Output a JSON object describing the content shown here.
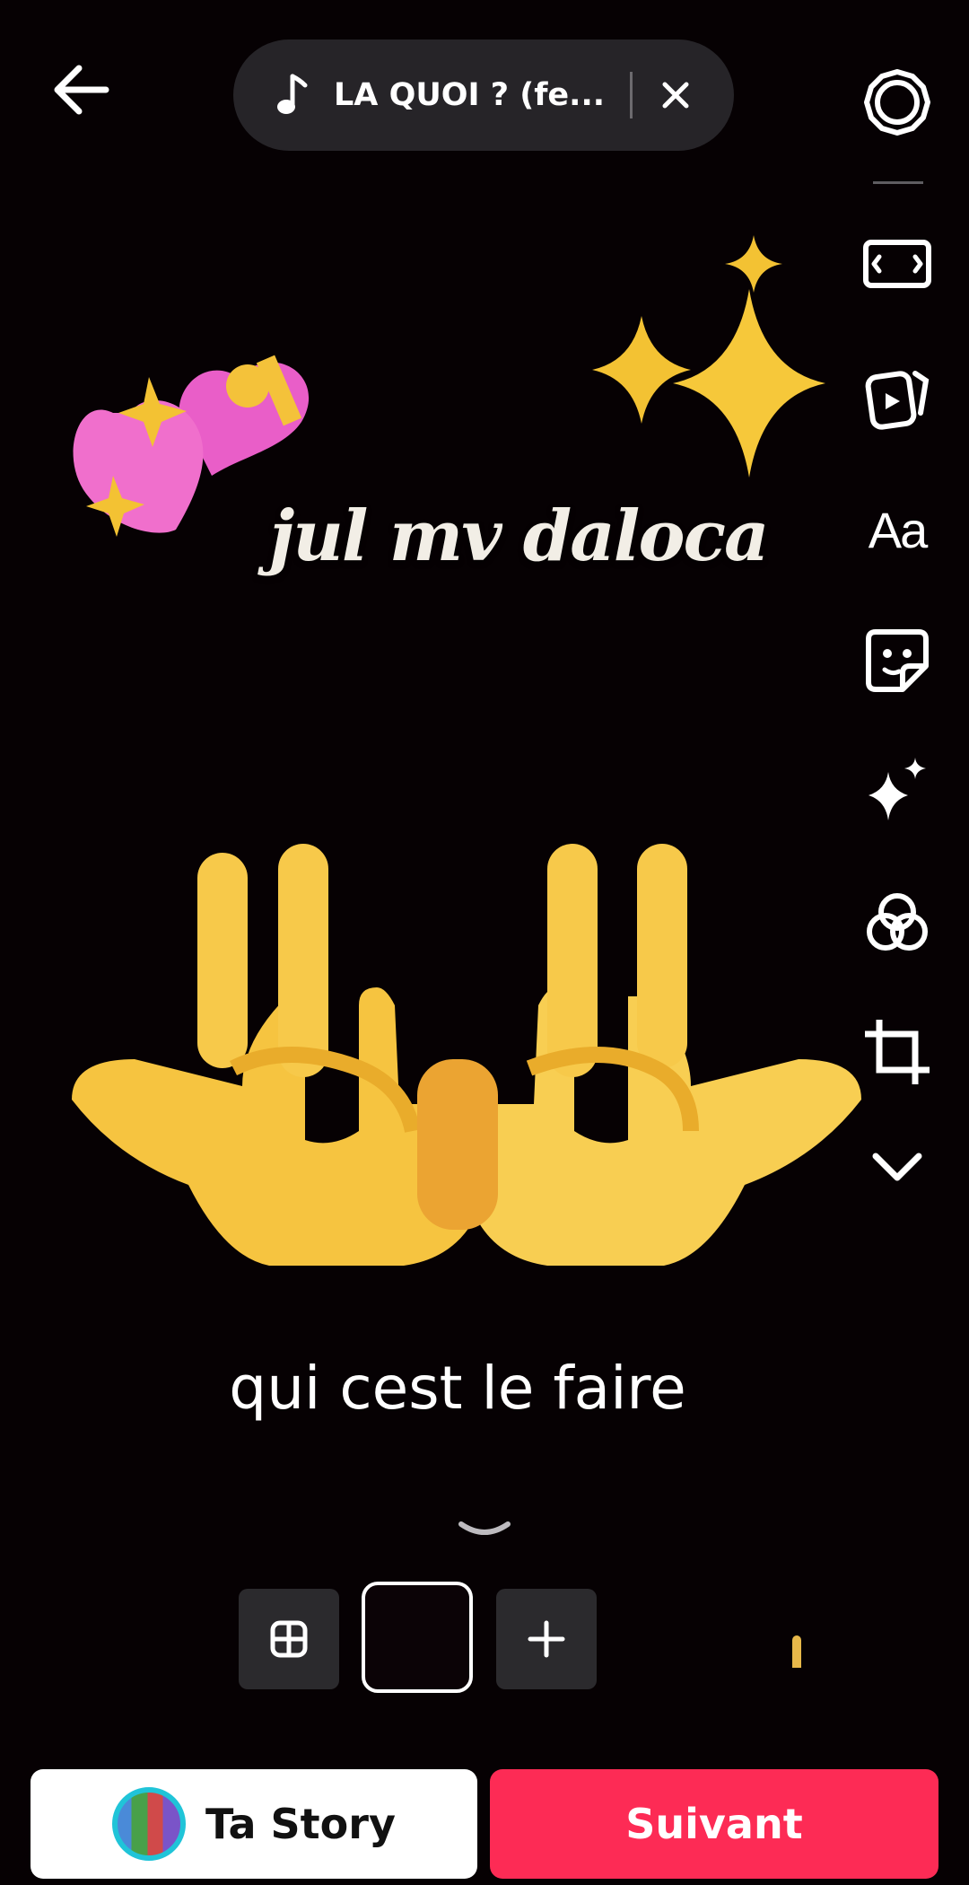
{
  "music": {
    "title": "LA QUOI ? (fe...",
    "icon": "music-note-icon",
    "close_icon": "close-icon"
  },
  "top": {
    "back_icon": "arrow-left-icon"
  },
  "rail": {
    "settings_icon": "gear-icon",
    "aspect_icon": "aspect-ratio-icon",
    "templates_icon": "video-templates-icon",
    "text_label": "Aa",
    "sticker_icon": "sticker-icon",
    "effects_icon": "sparkles-icon",
    "filters_icon": "filters-icon",
    "crop_icon": "crop-icon",
    "more_icon": "chevron-down-icon"
  },
  "canvas": {
    "sticker_text": "jul mv daloca",
    "caption": "qui cest le faire",
    "emoji_stickers": [
      "hearts-emoji",
      "sparkles-emoji",
      "hand-gesture-emoji"
    ]
  },
  "clips": {
    "collapse_icon": "chevron-down-icon",
    "grid_icon": "grid-icon",
    "add_icon": "plus-icon"
  },
  "bottom": {
    "story_label": "Ta Story",
    "next_label": "Suivant"
  },
  "colors": {
    "accent": "#fd2b55",
    "background": "#060103",
    "story_ring": "#20c4d8"
  }
}
